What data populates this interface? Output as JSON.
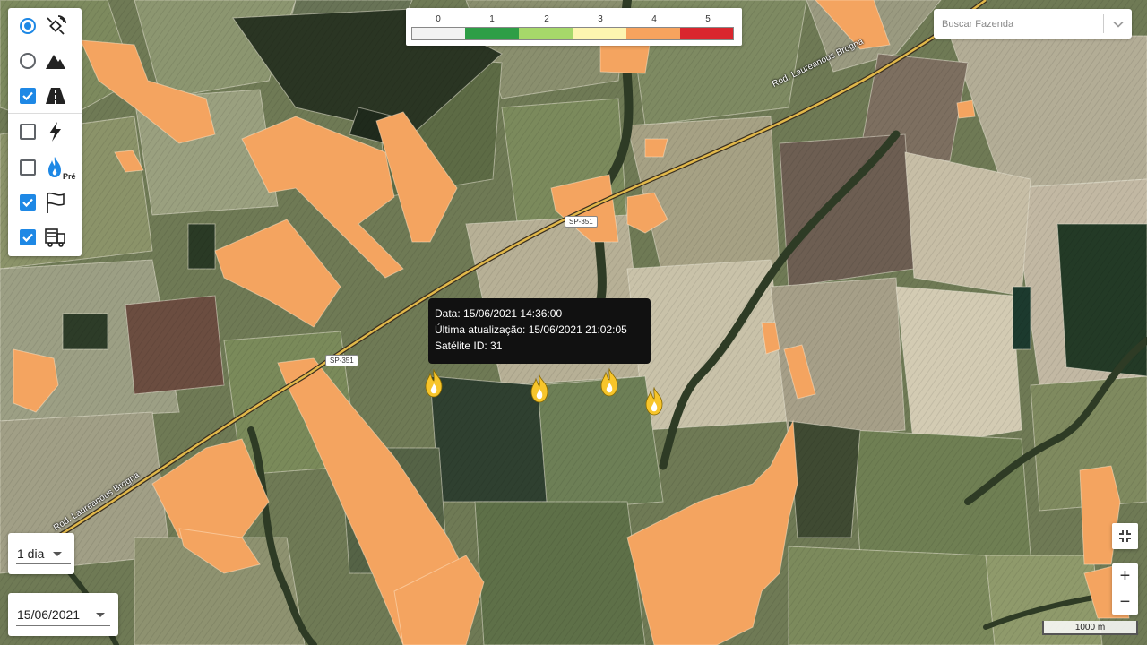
{
  "map": {
    "type": "satellite",
    "roads": [
      {
        "name": "Rod. Laureanous Brogna",
        "position": "upper-right"
      },
      {
        "name": "Rod. Laureanous Brogna",
        "position": "lower-left"
      }
    ],
    "shields": [
      "SP-351",
      "SP-351"
    ],
    "fire_markers": 4,
    "field_color": "#f4a460",
    "road_color": "#e1b84a"
  },
  "layer_panel": {
    "items": [
      {
        "control": "radio",
        "checked": true,
        "icon": "satellite-icon"
      },
      {
        "control": "radio",
        "checked": false,
        "icon": "terrain-icon"
      },
      {
        "control": "checkbox",
        "checked": true,
        "icon": "road-icon"
      },
      {
        "control": "checkbox",
        "checked": false,
        "icon": "lightning-icon"
      },
      {
        "control": "checkbox",
        "checked": false,
        "icon": "fire-pre-icon",
        "badge": "Pré"
      },
      {
        "control": "checkbox",
        "checked": true,
        "icon": "flag-icon"
      },
      {
        "control": "checkbox",
        "checked": true,
        "icon": "truck-icon"
      }
    ]
  },
  "legend": {
    "levels": [
      "0",
      "1",
      "2",
      "3",
      "4",
      "5"
    ],
    "colors": [
      "#f2f2f2",
      "#2e9e46",
      "#a6d86a",
      "#fdf5b0",
      "#f7a35e",
      "#d9262e"
    ]
  },
  "search": {
    "placeholder": "Buscar Fazenda"
  },
  "tooltip": {
    "date": "Data: 15/06/2021 14:36:00",
    "updated": "Última atualização: 15/06/2021 21:02:05",
    "satellite": "Satélite ID: 31"
  },
  "period_select": {
    "value": "1 dia"
  },
  "date_select": {
    "value": "15/06/2021"
  },
  "controls": {
    "zoom_in": "+",
    "zoom_out": "−"
  },
  "scale_bar": {
    "label": "1000 m"
  },
  "accent_color": "#1e88e5"
}
